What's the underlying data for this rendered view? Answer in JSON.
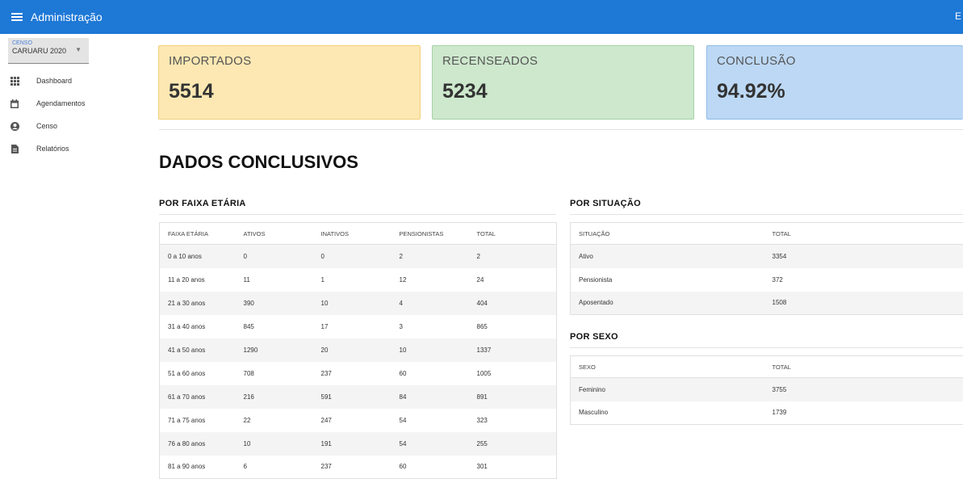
{
  "header": {
    "title": "Administração",
    "right_text": "E"
  },
  "sidebar": {
    "censo_label": "CENSO",
    "censo_value": "CARUARU 2020",
    "items": [
      {
        "label": "Dashboard",
        "icon": "grid-icon"
      },
      {
        "label": "Agendamentos",
        "icon": "calendar-icon"
      },
      {
        "label": "Censo",
        "icon": "user-circle-icon"
      },
      {
        "label": "Relatórios",
        "icon": "report-icon"
      }
    ]
  },
  "cards": [
    {
      "label": "IMPORTADOS",
      "value": "5514",
      "bg": "#fde8b3",
      "border": "#f1cf7a"
    },
    {
      "label": "RECENSEADOS",
      "value": "5234",
      "bg": "#cde8cd",
      "border": "#a6d2a6"
    },
    {
      "label": "CONCLUSÃO",
      "value": "94.92%",
      "bg": "#bcd8f4",
      "border": "#8fbbe8"
    }
  ],
  "section_title": "DADOS CONCLUSIVOS",
  "faixa": {
    "title": "POR FAIXA ETÁRIA",
    "headers": [
      "FAIXA ETÁRIA",
      "ATIVOS",
      "INATIVOS",
      "PENSIONISTAS",
      "TOTAL"
    ],
    "rows": [
      [
        "0 a 10 anos",
        "0",
        "0",
        "2",
        "2"
      ],
      [
        "11 a 20 anos",
        "11",
        "1",
        "12",
        "24"
      ],
      [
        "21 a 30 anos",
        "390",
        "10",
        "4",
        "404"
      ],
      [
        "31 a 40 anos",
        "845",
        "17",
        "3",
        "865"
      ],
      [
        "41 a 50 anos",
        "1290",
        "20",
        "10",
        "1337"
      ],
      [
        "51 a 60 anos",
        "708",
        "237",
        "60",
        "1005"
      ],
      [
        "61 a 70 anos",
        "216",
        "591",
        "84",
        "891"
      ],
      [
        "71 a 75 anos",
        "22",
        "247",
        "54",
        "323"
      ],
      [
        "76 a 80 anos",
        "10",
        "191",
        "54",
        "255"
      ],
      [
        "81 a 90 anos",
        "6",
        "237",
        "60",
        "301"
      ]
    ]
  },
  "situacao": {
    "title": "POR SITUAÇÃO",
    "headers": [
      "SITUAÇÃO",
      "TOTAL"
    ],
    "rows": [
      [
        "Ativo",
        "3354"
      ],
      [
        "Pensionista",
        "372"
      ],
      [
        "Aposentado",
        "1508"
      ]
    ]
  },
  "sexo": {
    "title": "POR SEXO",
    "headers": [
      "SEXO",
      "TOTAL"
    ],
    "rows": [
      [
        "Feminino",
        "3755"
      ],
      [
        "Masculino",
        "1739"
      ]
    ]
  }
}
